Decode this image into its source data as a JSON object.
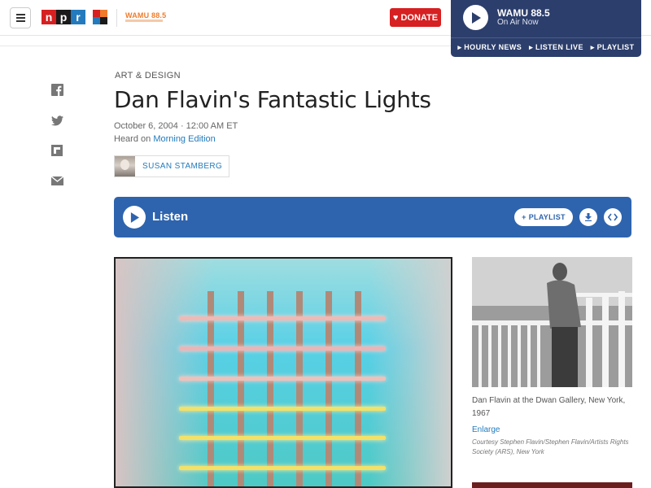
{
  "header": {
    "logo_letters": [
      "n",
      "p",
      "r"
    ],
    "station_logo": "WAMU 88.5",
    "donate_label": "DONATE",
    "menu_icon": "hamburger-icon"
  },
  "player": {
    "station": "WAMU 88.5",
    "status": "On Air Now",
    "links": [
      "HOURLY NEWS",
      "LISTEN LIVE",
      "PLAYLIST"
    ]
  },
  "share": {
    "icons": [
      "facebook-icon",
      "twitter-icon",
      "flipboard-icon",
      "email-icon"
    ]
  },
  "article": {
    "slug": "ART & DESIGN",
    "title": "Dan Flavin's Fantastic Lights",
    "date": "October 6, 2004 · 12:00 AM ET",
    "heard_on_prefix": "Heard on ",
    "heard_on_program": "Morning Edition",
    "author": "SUSAN STAMBERG"
  },
  "audio": {
    "listen_label": "Listen",
    "playlist_label": "PLAYLIST"
  },
  "side_figure": {
    "caption": "Dan Flavin at the Dwan Gallery, New York, 1967",
    "enlarge_label": "Enlarge",
    "credit": "Courtesy Stephen Flavin/Stephen Flavin/Artists Rights Society (ARS), New York"
  },
  "colors": {
    "npr_red": "#d62021",
    "npr_blue": "#237bbd",
    "player_bg": "#2c3e6b",
    "audio_bar": "#2e64ae"
  }
}
